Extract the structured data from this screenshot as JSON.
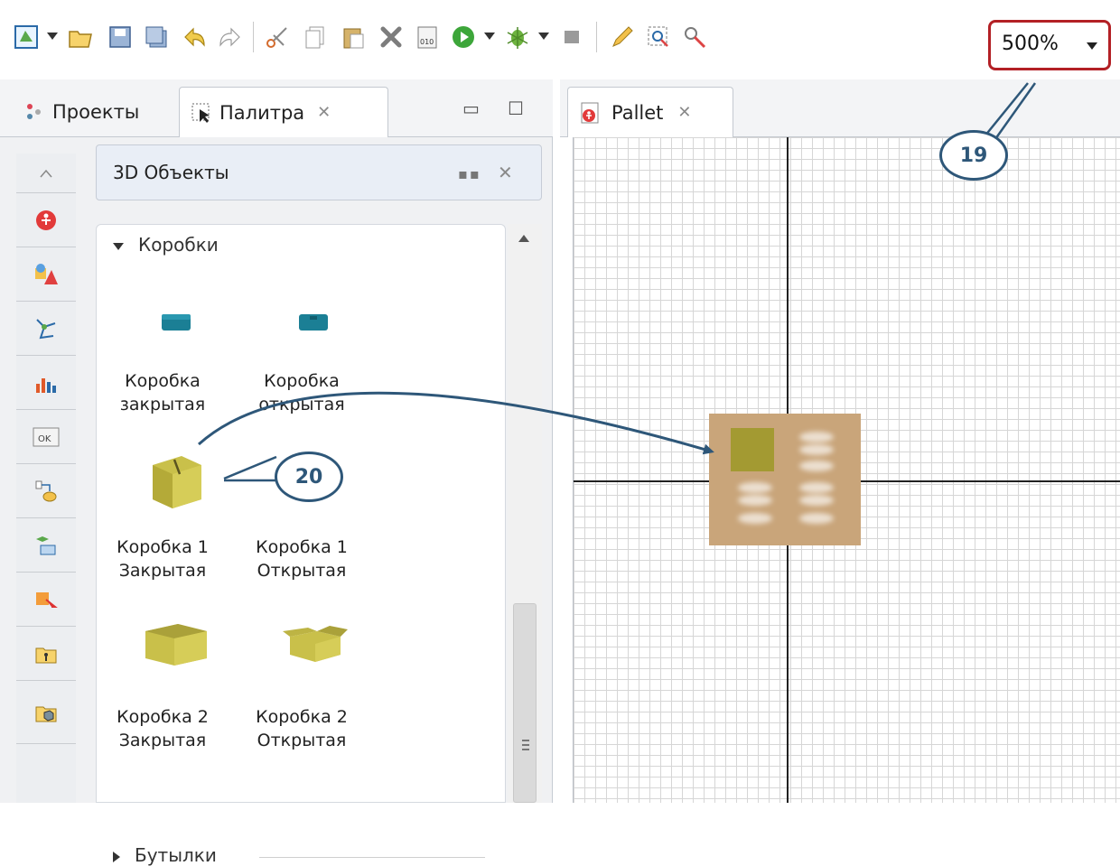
{
  "toolbar": {
    "icons": [
      "new-icon",
      "open-icon",
      "save-icon",
      "save-all-icon",
      "undo-icon",
      "redo-icon",
      "cut-icon",
      "copy-icon",
      "paste-icon",
      "delete-icon",
      "build-icon",
      "run-icon",
      "debug-icon",
      "stop-icon",
      "zoom-to-fit-icon",
      "zoom-icon"
    ],
    "zoom_value": "500%"
  },
  "left_panel": {
    "tabs": [
      {
        "label": "Проекты"
      },
      {
        "label": "Палитра"
      }
    ],
    "palette_title": "3D Объекты",
    "section": {
      "title": "Коробки",
      "items": [
        {
          "label_line1": "Коробка",
          "label_line2": "закрытая"
        },
        {
          "label_line1": "Коробка",
          "label_line2": "открытая"
        },
        {
          "label_line1": "Коробка 1",
          "label_line2": "Закрытая"
        },
        {
          "label_line1": "Коробка 1",
          "label_line2": "Открытая"
        },
        {
          "label_line1": "Коробка 2",
          "label_line2": "Закрытая"
        },
        {
          "label_line1": "Коробка 2",
          "label_line2": "Открытая"
        }
      ]
    },
    "collapsed_section": "Бутылки"
  },
  "editor": {
    "tab_label": "Pallet"
  },
  "callouts": {
    "zoom": "19",
    "box": "20"
  },
  "colors": {
    "accent_red": "#b32025",
    "callout_blue": "#2e5779",
    "pallet": "#c9a57a",
    "box_olive": "#a39a32",
    "teal_box": "#1b7f95"
  }
}
